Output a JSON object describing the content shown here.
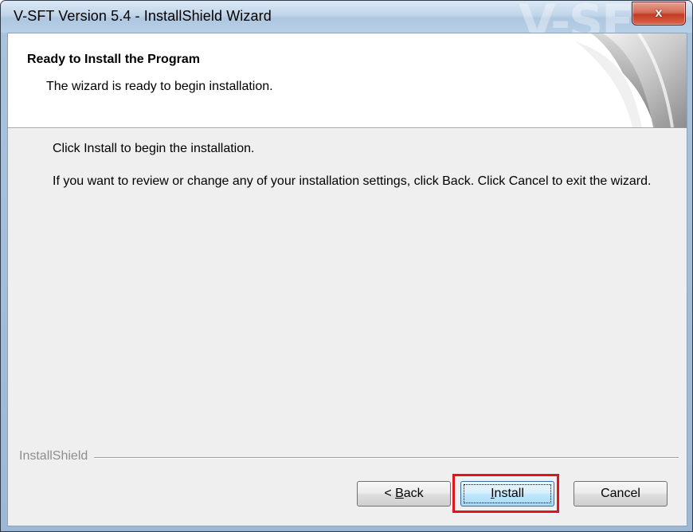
{
  "window": {
    "title": "V-SFT Version 5.4 - InstallShield Wizard",
    "watermark": "V-SF",
    "close_glyph": "x"
  },
  "header": {
    "title": "Ready to Install the Program",
    "subtitle": "The wizard is ready to begin installation."
  },
  "body": {
    "line1": "Click Install to begin the installation.",
    "line2": "If you want to review or change any of your installation settings, click Back. Click Cancel to exit the wizard."
  },
  "footer": {
    "brand": "InstallShield"
  },
  "buttons": {
    "back_prefix": "< ",
    "back_mnemonic": "B",
    "back_rest": "ack",
    "install_mnemonic": "I",
    "install_rest": "nstall",
    "cancel": "Cancel"
  },
  "icons": {
    "close": "close-icon",
    "header_art": "installshield-page-curl-icon"
  },
  "colors": {
    "highlight": "#e0141e",
    "close_button": "#c23b22"
  }
}
